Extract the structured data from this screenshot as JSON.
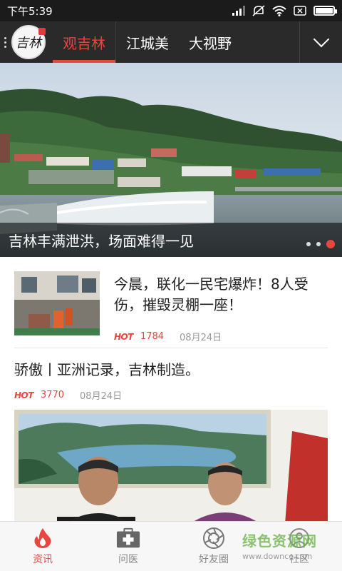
{
  "status_bar": {
    "time": "下午5:39",
    "icons": [
      "signal-icon",
      "mute-icon",
      "wifi-icon",
      "sim-error-icon",
      "battery-icon"
    ]
  },
  "header": {
    "logo_text": "吉林",
    "tabs": [
      {
        "label": "观吉林",
        "active": true
      },
      {
        "label": "江城美",
        "active": false
      },
      {
        "label": "大视野",
        "active": false
      }
    ],
    "more_icon": "chevron-down-icon"
  },
  "hero": {
    "caption": "吉林丰满泄洪，场面难得一见",
    "pages": 3,
    "current_page": 3
  },
  "feed": {
    "items": [
      {
        "title": "今晨，联化一民宅爆炸！8人受伤，摧毁灵棚一座！",
        "hot_label": "HOT",
        "hot_count": "1784",
        "date": "08月24日"
      },
      {
        "title": "骄傲丨亚洲记录，吉林制造。",
        "hot_label": "HOT",
        "hot_count": "3770",
        "date": "08月24日"
      }
    ]
  },
  "bottom_nav": {
    "items": [
      {
        "label": "资讯",
        "icon": "flame-icon",
        "active": true
      },
      {
        "label": "问医",
        "icon": "medical-kit-icon",
        "active": false
      },
      {
        "label": "好友圈",
        "icon": "camera-lens-icon",
        "active": false
      },
      {
        "label": "社区",
        "icon": "community-icon",
        "active": false
      }
    ]
  },
  "watermark": {
    "text": "绿色资源网",
    "url": "www.downcc.com"
  },
  "colors": {
    "accent": "#e8473f",
    "header_bg": "#2a2a2a",
    "status_bg": "#1b1b1b"
  }
}
